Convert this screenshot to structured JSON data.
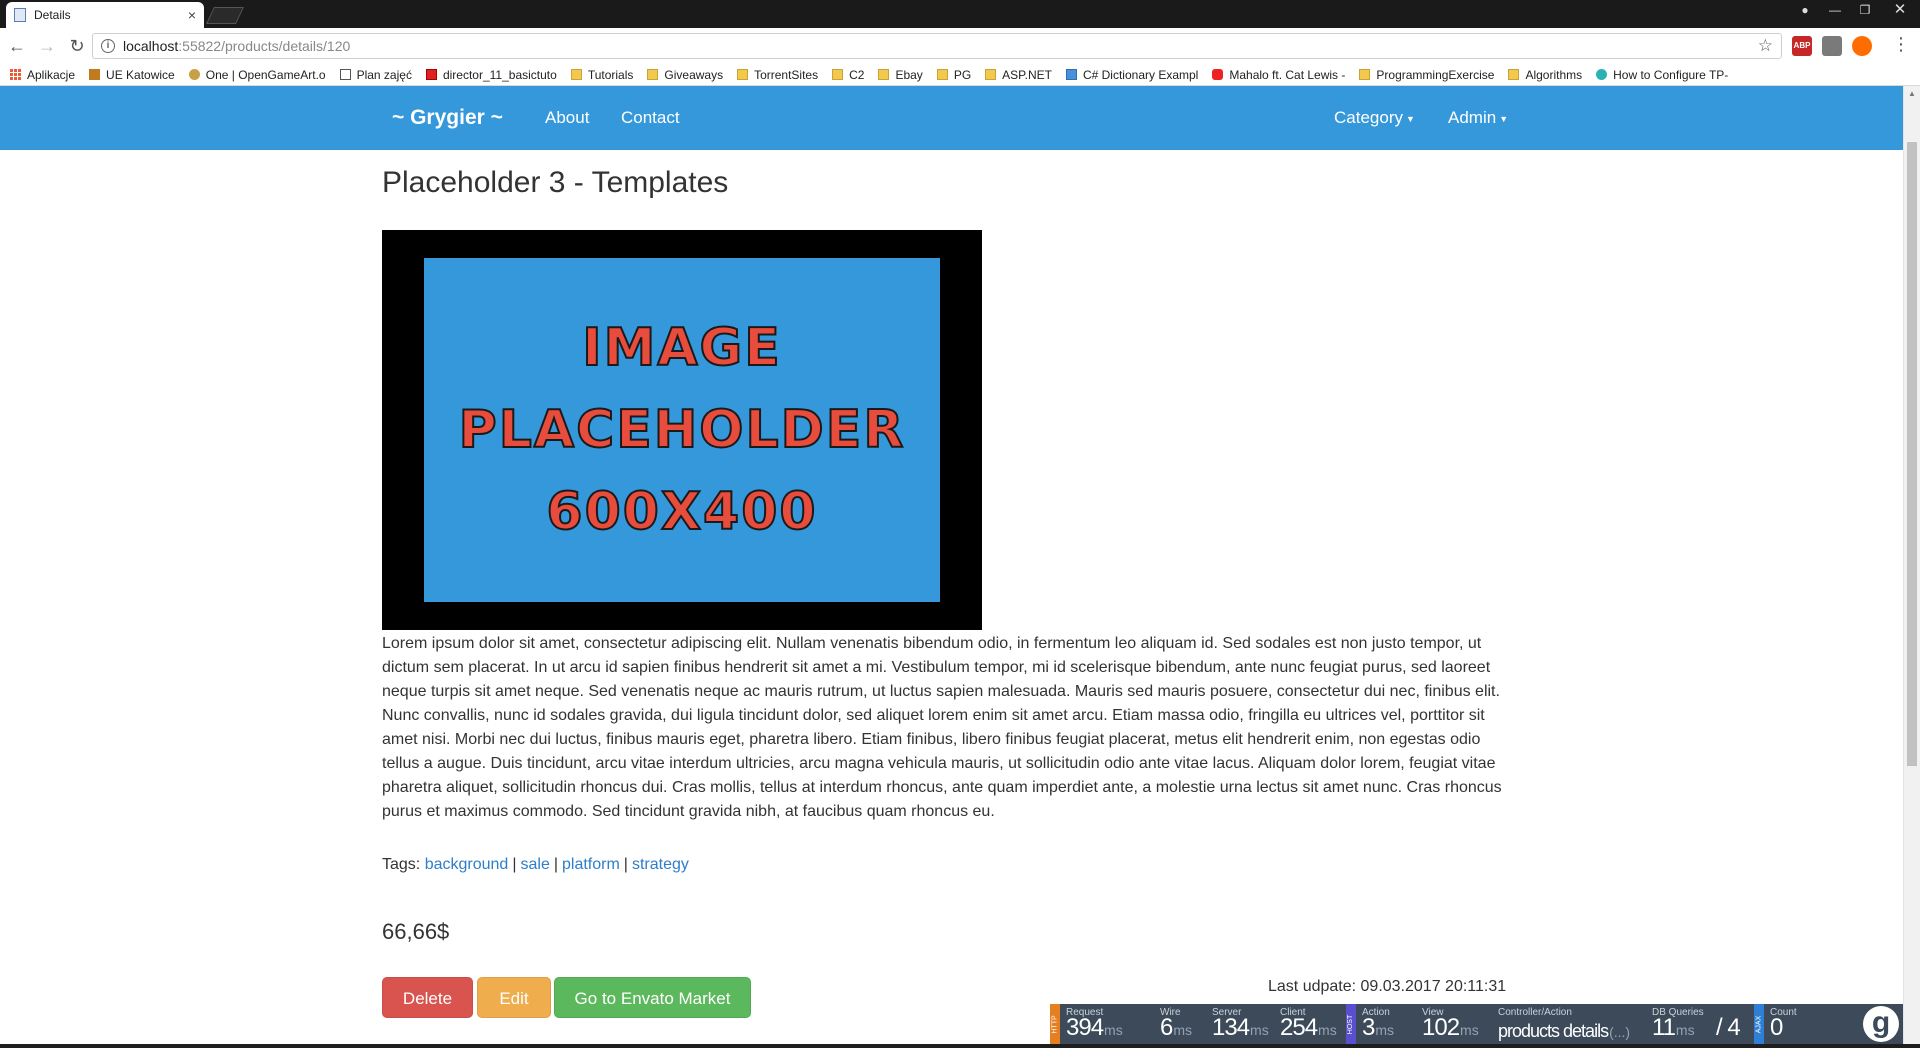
{
  "browser": {
    "tab_title": "Details",
    "tab_close": "×",
    "url_host": "localhost",
    "url_rest": ":55822/products/details/120",
    "window_controls": [
      "—",
      "❐",
      "✕"
    ],
    "bookmarks": [
      {
        "label": "Aplikacje",
        "icon": "apps-grid-icon"
      },
      {
        "label": "UE Katowice",
        "icon": "ue-logo-icon"
      },
      {
        "label": "One | OpenGameArt.o",
        "icon": "opengameart-icon"
      },
      {
        "label": "Plan zajęć",
        "icon": "page-icon"
      },
      {
        "label": "director_11_basictuto",
        "icon": "adobe-icon"
      },
      {
        "label": "Tutorials",
        "icon": "folder-icon"
      },
      {
        "label": "Giveaways",
        "icon": "folder-icon"
      },
      {
        "label": "TorrentSites",
        "icon": "folder-icon"
      },
      {
        "label": "C2",
        "icon": "folder-icon"
      },
      {
        "label": "Ebay",
        "icon": "folder-icon"
      },
      {
        "label": "PG",
        "icon": "folder-icon"
      },
      {
        "label": "ASP.NET",
        "icon": "folder-icon"
      },
      {
        "label": "C# Dictionary Exampl",
        "icon": "site-icon"
      },
      {
        "label": "Mahalo ft. Cat Lewis -",
        "icon": "youtube-icon"
      },
      {
        "label": "ProgrammingExercise",
        "icon": "folder-icon"
      },
      {
        "label": "Algorithms",
        "icon": "folder-icon"
      },
      {
        "label": "How to Configure TP-",
        "icon": "tp-link-icon"
      }
    ],
    "extensions": [
      {
        "label": "ABP",
        "color": "#c62828"
      },
      {
        "label": "",
        "color": "#7a7a7a"
      },
      {
        "label": "",
        "color": "#ff6d00"
      }
    ]
  },
  "site": {
    "brand": "~ Grygier ~",
    "nav": {
      "about": "About",
      "contact": "Contact",
      "category": "Category",
      "admin": "Admin"
    },
    "accent": "#3498db"
  },
  "product": {
    "title": "Placeholder 3 - Templates",
    "image_text": [
      "IMAGE",
      "PLACEHOLDER",
      "600X400"
    ],
    "description": "Lorem ipsum dolor sit amet, consectetur adipiscing elit. Nullam venenatis bibendum odio, in fermentum leo aliquam id. Sed sodales est non justo tempor, ut dictum sem placerat. In ut arcu id sapien finibus hendrerit sit amet a mi. Vestibulum tempor, mi id scelerisque bibendum, ante nunc feugiat purus, sed laoreet neque turpis sit amet neque. Sed venenatis neque ac mauris rutrum, ut luctus sapien malesuada. Mauris sed mauris posuere, consectetur dui nec, finibus elit. Nunc convallis, nunc id sodales gravida, dui ligula tincidunt dolor, sed aliquet lorem enim sit amet arcu. Etiam massa odio, fringilla eu ultrices vel, porttitor sit amet nisi. Morbi nec dui luctus, finibus mauris eget, pharetra libero. Etiam finibus, libero finibus feugiat placerat, metus elit hendrerit enim, non egestas odio tellus a augue. Duis tincidunt, arcu vitae interdum ultricies, arcu magna vehicula mauris, ut sollicitudin odio ante vitae lacus. Aliquam dolor lorem, feugiat vitae pharetra aliquet, sollicitudin rhoncus dui. Cras mollis, tellus at interdum rhoncus, ante quam imperdiet ante, a molestie urna lectus sit amet nunc. Cras rhoncus purus et maximus commodo. Sed tincidunt gravida nibh, at faucibus quam rhoncus eu.",
    "tags_label": "Tags:",
    "tags": [
      "background",
      "sale",
      "platform",
      "strategy"
    ],
    "price": "66,66$",
    "last_update": "Last udpate: 09.03.2017 20:11:31",
    "buttons": {
      "delete": "Delete",
      "edit": "Edit",
      "envato": "Go to Envato Market"
    },
    "button_colors": {
      "delete": "#d9534f",
      "edit": "#f0ad4e",
      "envato": "#5cb85c"
    }
  },
  "glimpse": {
    "http_label": "HTTP",
    "host_label": "HOST",
    "ajax_label": "AJAX",
    "metrics": [
      {
        "label": "Request",
        "value": "394",
        "unit": "ms"
      },
      {
        "label": "Wire",
        "value": "6",
        "unit": "ms"
      },
      {
        "label": "Server",
        "value": "134",
        "unit": "ms"
      },
      {
        "label": "Client",
        "value": "254",
        "unit": "ms"
      },
      {
        "label": "Action",
        "value": "3",
        "unit": "ms"
      },
      {
        "label": "View",
        "value": "102",
        "unit": "ms"
      },
      {
        "label": "Controller/Action",
        "value": "products details",
        "unit": "(...)"
      },
      {
        "label": "DB Queries",
        "value": "11",
        "unit": "ms"
      },
      {
        "label": "",
        "value": "/ 4",
        "unit": ""
      },
      {
        "label": "Count",
        "value": "0",
        "unit": ""
      }
    ],
    "logo": "g"
  }
}
